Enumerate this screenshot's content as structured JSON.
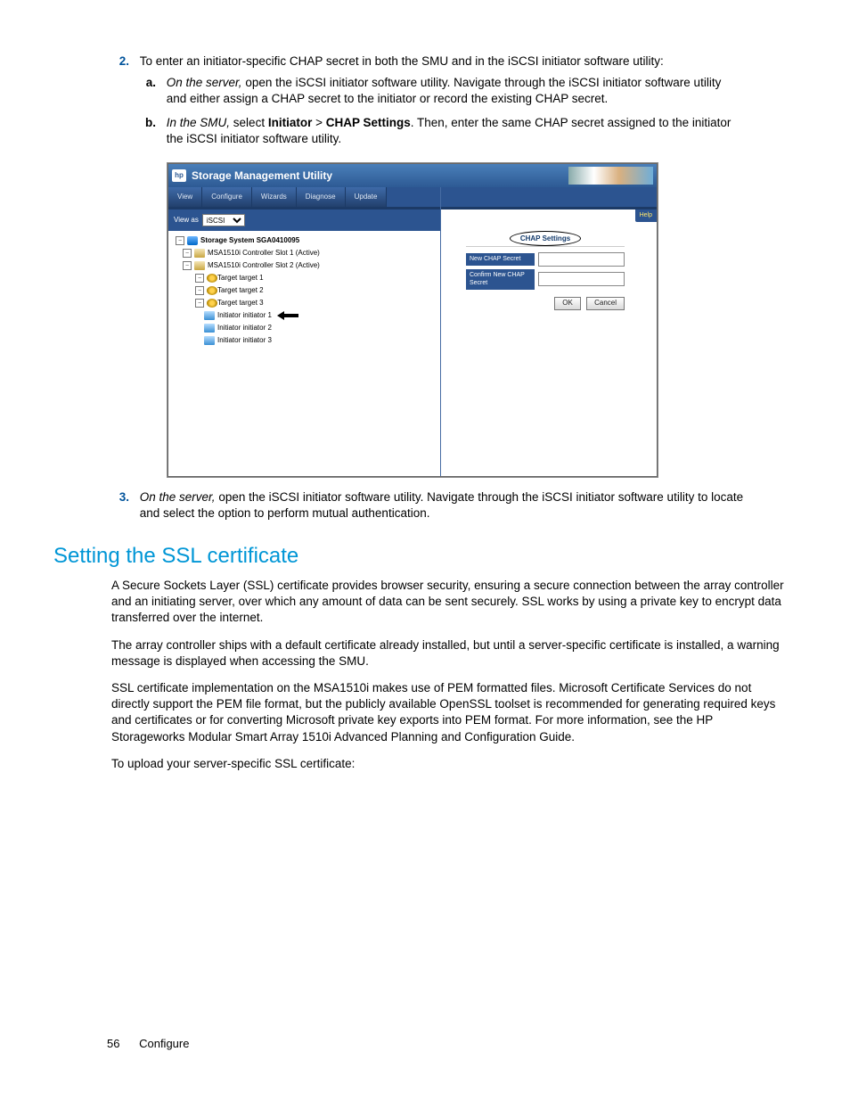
{
  "step2": {
    "num": "2.",
    "text": "To enter an initiator-specific CHAP secret in both the SMU and in the iSCSI initiator software utility:"
  },
  "step2a": {
    "letter": "a.",
    "italic": "On the server,",
    "rest": " open the iSCSI initiator software utility. Navigate through the iSCSI initiator software utility and either assign a CHAP secret to the initiator or record the existing CHAP secret."
  },
  "step2b": {
    "letter": "b.",
    "italic": "In the SMU,",
    "plain1": " select ",
    "b1": "Initiator",
    "gt": " > ",
    "b2": "CHAP Settings",
    "rest": ". Then, enter the same CHAP secret assigned to the initiator the iSCSI initiator software utility."
  },
  "step3": {
    "num": "3.",
    "italic": "On the server,",
    "rest": " open the iSCSI initiator software utility. Navigate through the iSCSI initiator software utility to locate and select the option to perform mutual authentication."
  },
  "section_heading": "Setting the SSL certificate",
  "p1": "A Secure Sockets Layer (SSL) certificate provides browser security, ensuring a secure connection between the array controller and an initiating server, over which any amount of data can be sent securely. SSL works by using a private key to encrypt data transferred over the internet.",
  "p2": "The array controller ships with a default certificate already installed, but until a server-specific certificate is installed, a warning message is displayed when accessing the SMU.",
  "p3": "SSL certificate implementation on the MSA1510i makes use of PEM formatted files. Microsoft Certificate Services do not directly support the PEM file format, but the publicly available OpenSSL toolset is recommended for generating required keys and certificates or for converting Microsoft private key exports into PEM format. For more information, see the HP Storageworks Modular Smart Array 1510i Advanced Planning and Configuration Guide.",
  "p4": "To upload your server-specific SSL certificate:",
  "footer": {
    "page": "56",
    "section": "Configure"
  },
  "screenshot": {
    "logo": "hp",
    "title": "Storage Management Utility",
    "tabs": [
      "View",
      "Configure",
      "Wizards",
      "Diagnose",
      "Update"
    ],
    "help": "Help",
    "viewas_label": "View as",
    "viewas_value": "iSCSI",
    "tree": {
      "root": "Storage System SGA0410095",
      "ctrl1": "MSA1510i Controller Slot 1 (Active)",
      "ctrl2": "MSA1510i Controller Slot 2 (Active)",
      "tgt1": "Target target 1",
      "tgt2": "Target target 2",
      "tgt3": "Target target 3",
      "init1": "Initiator initiator 1",
      "init2": "Initiator initiator 2",
      "init3": "Initiator initiator 3"
    },
    "panel": {
      "heading": "CHAP Settings",
      "field1": "New CHAP Secret",
      "field2": "Confirm New CHAP Secret",
      "ok": "OK",
      "cancel": "Cancel"
    }
  }
}
